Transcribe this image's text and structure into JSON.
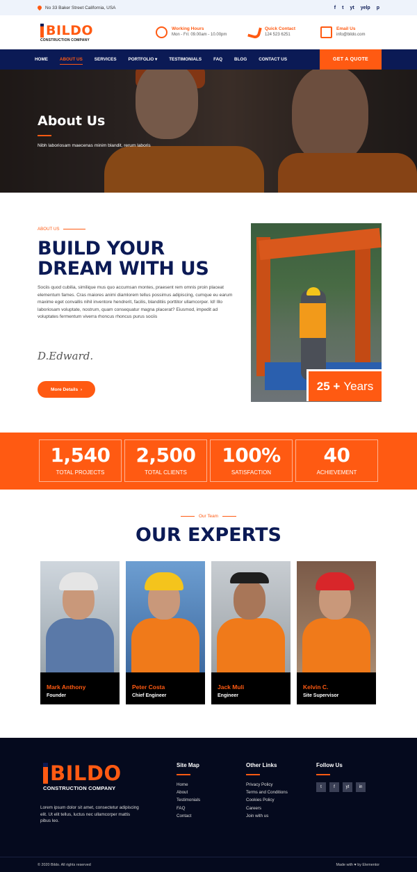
{
  "topbar": {
    "address": "No 33 Baker Street California, USA",
    "social": [
      "f",
      "t",
      "yt",
      "yelp",
      "p"
    ]
  },
  "brand": {
    "name": "BILDO",
    "sub": "CONSTRUCTION COMPANY"
  },
  "header_info": [
    {
      "title": "Working Hours",
      "detail": "Mon - Fri: 09.00am - 10.00pm",
      "icon": "clock-icon"
    },
    {
      "title": "Quick Contact",
      "detail": "124 523 6251",
      "icon": "phone-icon"
    },
    {
      "title": "Email Us",
      "detail": "info@bildo.com",
      "icon": "envelope-icon"
    }
  ],
  "nav": {
    "items": [
      "HOME",
      "ABOUT US",
      "SERVICES",
      "PORTFOLIO",
      "TESTIMONIALS",
      "FAQ",
      "BLOG",
      "CONTACT US"
    ],
    "quote": "GET A QUOTE"
  },
  "hero": {
    "title": "About Us",
    "subtitle": "Nibh laboriosam maecenas minim blandit, rerum laboris"
  },
  "about": {
    "kicker": "ABOUT US",
    "heading": "BUILD YOUR DREAM WITH US",
    "body": "Sociis quod cubilia, similique mus quo accumsan montes, praesent rem omnis proin placeat elementum fames. Cras maiores animi diamlorem tellus possimus adipiscing, cumque eu earum maxime eget convallis nihil inventore hendrerit, facilis, blanditiis porttitor ullamcorper. Id! Illo laboriosam voluptate, nostrum, quam consequatur magna placerat? Eiusmod, impedit ad voluptates fermentum viverra rhoncus rhoncus purus sociis",
    "signature": "D.Edward.",
    "button": "More Details",
    "years_num": "25 +",
    "years_label": "Years"
  },
  "stats": [
    {
      "value": "1,540",
      "label": "TOTAL PROJECTS"
    },
    {
      "value": "2,500",
      "label": "TOTAL CLIENTS"
    },
    {
      "value": "100%",
      "label": "SATISFACTION"
    },
    {
      "value": "40",
      "label": "ACHIEVEMENT"
    }
  ],
  "team": {
    "kicker": "Our Team",
    "heading": "OUR EXPERTS",
    "members": [
      {
        "name": "Mark Anthony",
        "role": "Founder"
      },
      {
        "name": "Peter Costa",
        "role": "Chief Engineer"
      },
      {
        "name": "Jack Muli",
        "role": "Engineer"
      },
      {
        "name": "Kelvin C.",
        "role": "Site Supervisor"
      }
    ]
  },
  "footer": {
    "desc": "Lorem ipsum dolor sit amet, consectetur adipiscing elit. Ut elit tellus, luctus nec ullamcorper mattis pibus leo.",
    "sitemap": {
      "title": "Site Map",
      "items": [
        "Home",
        "About",
        "Testimonials",
        "FAQ",
        "Contact"
      ]
    },
    "other": {
      "title": "Other Links",
      "items": [
        "Privacy Policy",
        "Terms and Conditions",
        "Cookies Policy",
        "Careers",
        "Join with us"
      ]
    },
    "follow": {
      "title": "Follow Us",
      "icons": [
        "t",
        "f",
        "yt",
        "in"
      ]
    },
    "copyright": "© 2020 Bildo. All rights reserved",
    "made": "Made with ♥ by Elementor"
  },
  "colors": {
    "accent": "#ff5a12",
    "navy": "#0b1a55",
    "footer": "#050a1e"
  }
}
